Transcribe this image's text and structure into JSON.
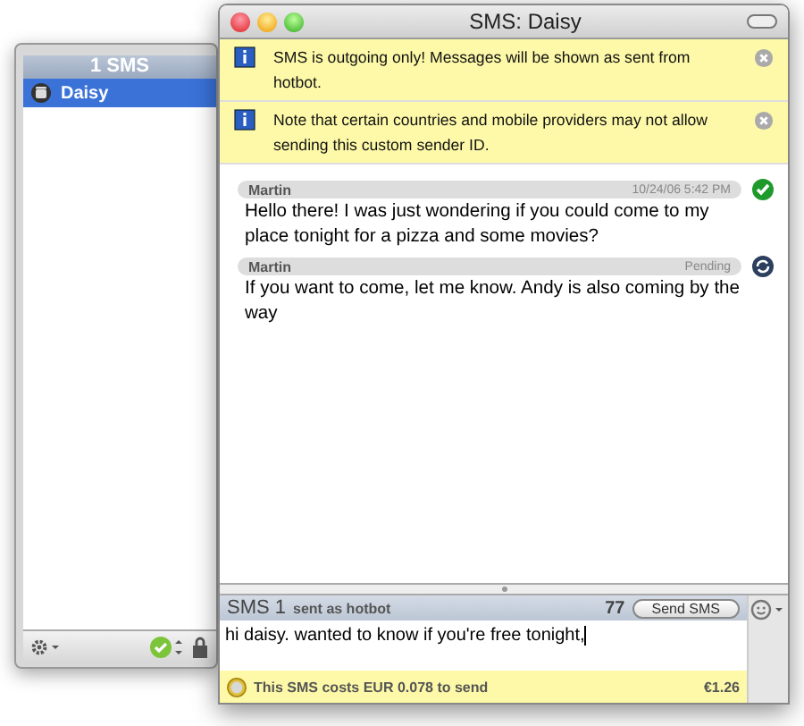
{
  "sidebar": {
    "header": "1 SMS",
    "contacts": [
      {
        "name": "Daisy",
        "selected": true
      }
    ]
  },
  "window": {
    "title": "SMS: Daisy"
  },
  "notices": [
    {
      "text": "SMS is outgoing only! Messages will be shown as sent from hotbot."
    },
    {
      "text": "Note that certain countries and mobile providers may not allow sending this custom sender ID."
    }
  ],
  "messages": [
    {
      "sender": "Martin",
      "meta": "10/24/06 5:42 PM",
      "delivered": true,
      "text": "Hello there! I was just wondering if you could come to my place tonight for a pizza and some movies?"
    },
    {
      "sender": "Martin",
      "meta": "Pending",
      "delivered": false,
      "text": "If you want to come, let me know. Andy is also coming by the way"
    }
  ],
  "compose": {
    "title": "SMS 1",
    "subtitle": "sent as hotbot",
    "count": "77",
    "button": "Send SMS",
    "value": "hi daisy. wanted to know if you're free tonight,",
    "cost": "This SMS costs EUR 0.078 to send",
    "balance": "€1.26"
  }
}
